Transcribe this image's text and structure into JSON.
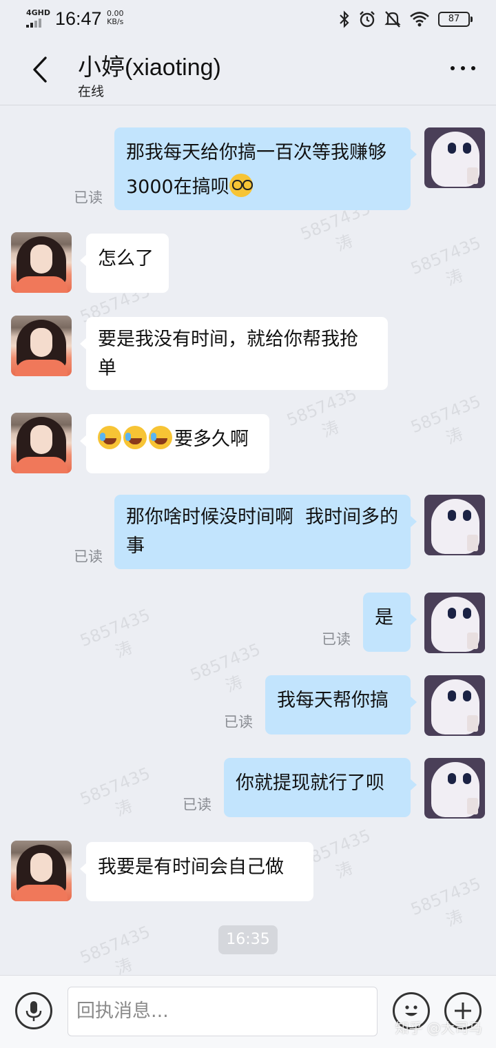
{
  "status_bar": {
    "network": "4GHD",
    "time": "16:47",
    "speed_value": "0.00",
    "speed_unit": "KB/s",
    "battery": "87",
    "icons": [
      "bluetooth-icon",
      "alarm-icon",
      "mute-icon",
      "wifi-icon",
      "battery-icon"
    ]
  },
  "header": {
    "back_icon": "chevron-left-icon",
    "title": "小婷(xiaoting)",
    "subtitle": "在线",
    "more_icon": "more-dots-icon"
  },
  "watermark": {
    "number": "5857435",
    "char": "涛"
  },
  "messages": [
    {
      "side": "right",
      "text": "那我每天给你搞一百次等我赚够3000在搞呗",
      "emoji": "glasses-emoji-icon",
      "read": "已读"
    },
    {
      "side": "left",
      "text": "怎么了"
    },
    {
      "side": "left",
      "text": "要是我没有时间，就给你帮我抢单"
    },
    {
      "side": "left",
      "text": "要多久啊",
      "emoji": "crying-emoji-icon"
    },
    {
      "side": "right",
      "text": "那你啥时候没时间啊  我时间多的事",
      "read": "已读"
    },
    {
      "side": "right",
      "text": "是",
      "read": "已读"
    },
    {
      "side": "right",
      "text": "我每天帮你搞",
      "read": "已读"
    },
    {
      "side": "right",
      "text": "你就提现就行了呗",
      "read": "已读"
    },
    {
      "side": "left",
      "text": "我要是有时间会自己做"
    }
  ],
  "timestamp": "16:35",
  "input_bar": {
    "voice_icon": "microphone-icon",
    "placeholder": "回执消息...",
    "emoji_icon": "smiley-icon",
    "plus_icon": "plus-icon",
    "watermark_text": "知乎 @大司马"
  },
  "colors": {
    "background": "#eceef3",
    "bubble_self": "#c2e4fd",
    "bubble_other": "#ffffff",
    "read_text": "#8a8d93"
  }
}
